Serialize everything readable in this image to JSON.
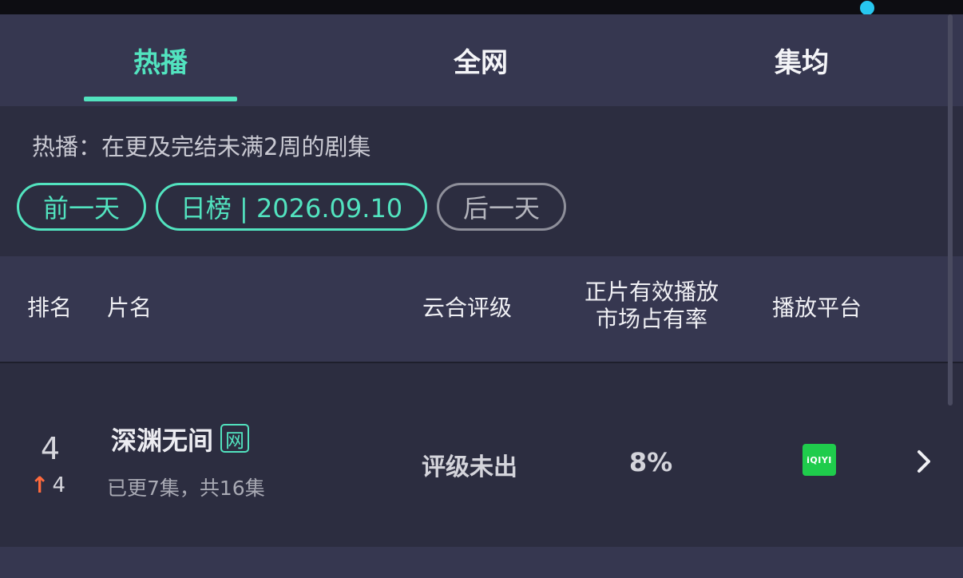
{
  "tabs": [
    {
      "label": "热播",
      "active": true
    },
    {
      "label": "全网",
      "active": false
    },
    {
      "label": "集均",
      "active": false
    }
  ],
  "filter": {
    "description": "热播：在更及完结未满2周的剧集",
    "prev_label": "前一天",
    "current_label": "日榜 | 2026.09.10",
    "next_label": "后一天"
  },
  "table": {
    "headers": {
      "rank": "排名",
      "title": "片名",
      "rating": "云合评级",
      "share_line1": "正片有效播放",
      "share_line2": "市场占有率",
      "platform": "播放平台"
    },
    "rows": [
      {
        "rank": "4",
        "rank_change": "4",
        "title": "深渊无间",
        "badge": "网",
        "episodes": "已更7集，共16集",
        "rating": "评级未出",
        "share": "8%",
        "platform": "iQIYI"
      }
    ]
  },
  "colors": {
    "accent": "#52e3bf",
    "up": "#ff6a3d",
    "iqiyi": "#1fcc4c"
  },
  "icons": [
    "up-arrow-icon",
    "iqiyi-logo",
    "chevron-right-icon"
  ]
}
